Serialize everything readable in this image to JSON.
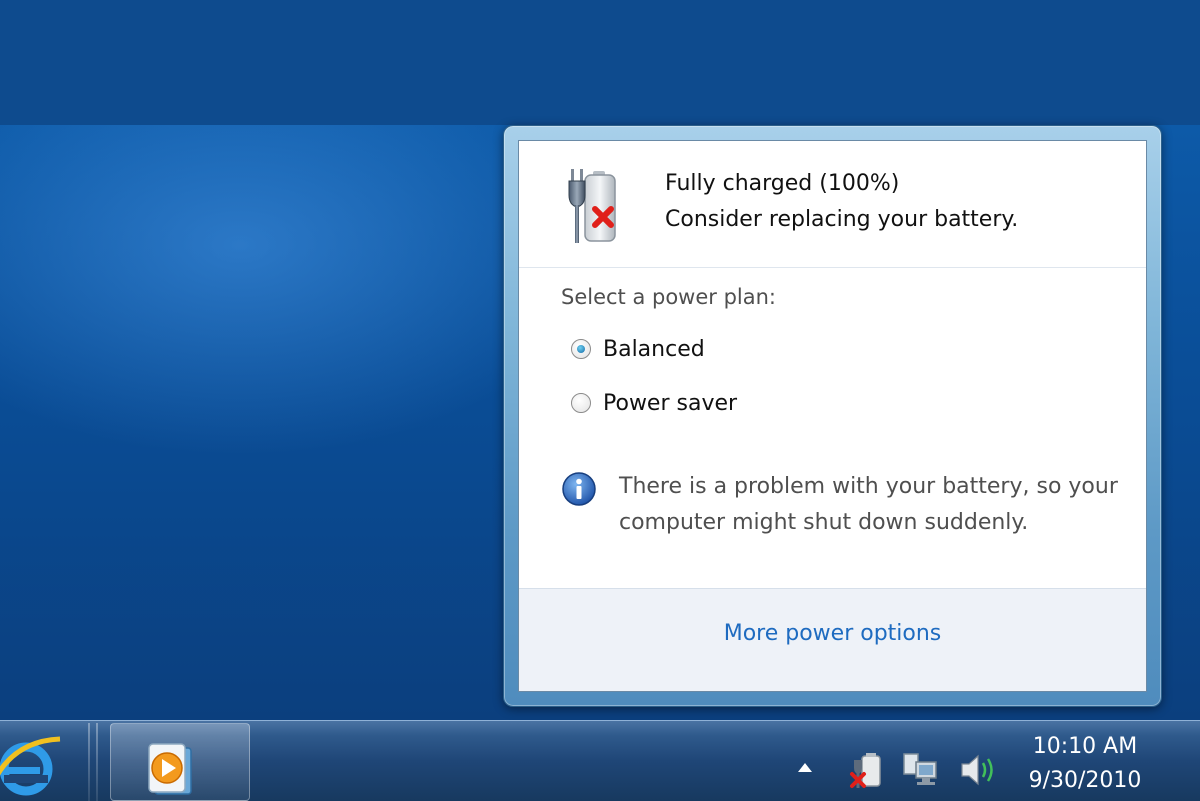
{
  "flyout": {
    "status_line1": "Fully charged (100%)",
    "status_line2": "Consider replacing your battery.",
    "plan_heading": "Select a power plan:",
    "plans": [
      {
        "label": "Balanced",
        "selected": true
      },
      {
        "label": "Power saver",
        "selected": false
      }
    ],
    "info_message": "There is a problem with your battery, so your computer might shut down suddenly.",
    "more_options_link": "More power options"
  },
  "taskbar": {
    "pinned": [
      {
        "icon": "internet-explorer-icon"
      },
      {
        "icon": "windows-media-player-icon"
      }
    ],
    "tray": {
      "icons": [
        "show-hidden-icons-arrow",
        "power-warning-icon",
        "network-icon",
        "volume-icon"
      ],
      "time": "10:10 AM",
      "date": "9/30/2010"
    }
  },
  "colors": {
    "desktop": "#0d5aa8",
    "link": "#1e6bc0",
    "warning_x": "#e0201a"
  }
}
